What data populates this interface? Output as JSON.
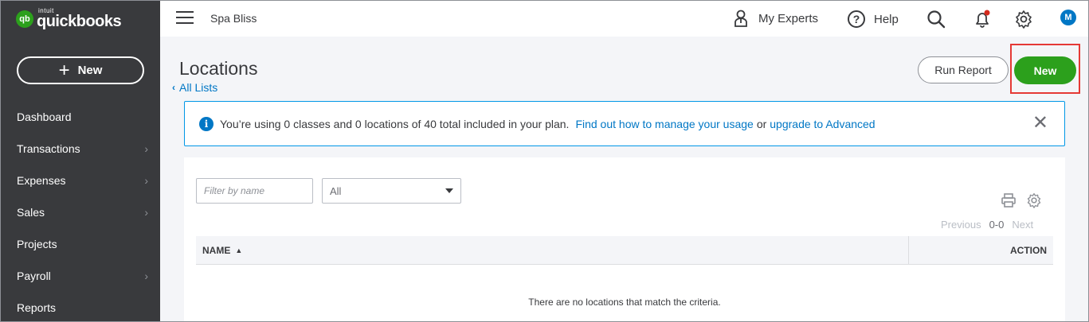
{
  "brand": {
    "intuit": "intuit",
    "name": "quickbooks",
    "mark": "qb"
  },
  "sidebar": {
    "new_label": "New",
    "items": [
      {
        "label": "Dashboard",
        "chevron": false
      },
      {
        "label": "Transactions",
        "chevron": true
      },
      {
        "label": "Expenses",
        "chevron": true
      },
      {
        "label": "Sales",
        "chevron": true
      },
      {
        "label": "Projects",
        "chevron": false
      },
      {
        "label": "Payroll",
        "chevron": true
      },
      {
        "label": "Reports",
        "chevron": false
      }
    ]
  },
  "topbar": {
    "company": "Spa Bliss",
    "my_experts": "My Experts",
    "help": "Help",
    "avatar_initial": "M",
    "icons": [
      "hamburger-icon",
      "experts-icon",
      "help-icon",
      "search-icon",
      "notification-bell-icon",
      "gear-icon"
    ]
  },
  "page": {
    "title": "Locations",
    "back_link": "All Lists",
    "run_report": "Run Report",
    "new_button": "New"
  },
  "banner": {
    "text": "You’re using 0 classes and 0 locations of 40 total included in your plan.",
    "link1": "Find out how to manage your usage",
    "or": "or",
    "link2": "upgrade to Advanced"
  },
  "table": {
    "filter_placeholder": "Filter by name",
    "select_value": "All",
    "pager": {
      "previous": "Previous",
      "range": "0-0",
      "next": "Next"
    },
    "columns": {
      "name": "NAME",
      "action": "ACTION"
    },
    "empty_message": "There are no locations that match the criteria."
  },
  "colors": {
    "brand_green": "#2ca01c",
    "link_blue": "#0077c5",
    "sidebar_bg": "#393a3d",
    "highlight_red": "#e53935"
  }
}
